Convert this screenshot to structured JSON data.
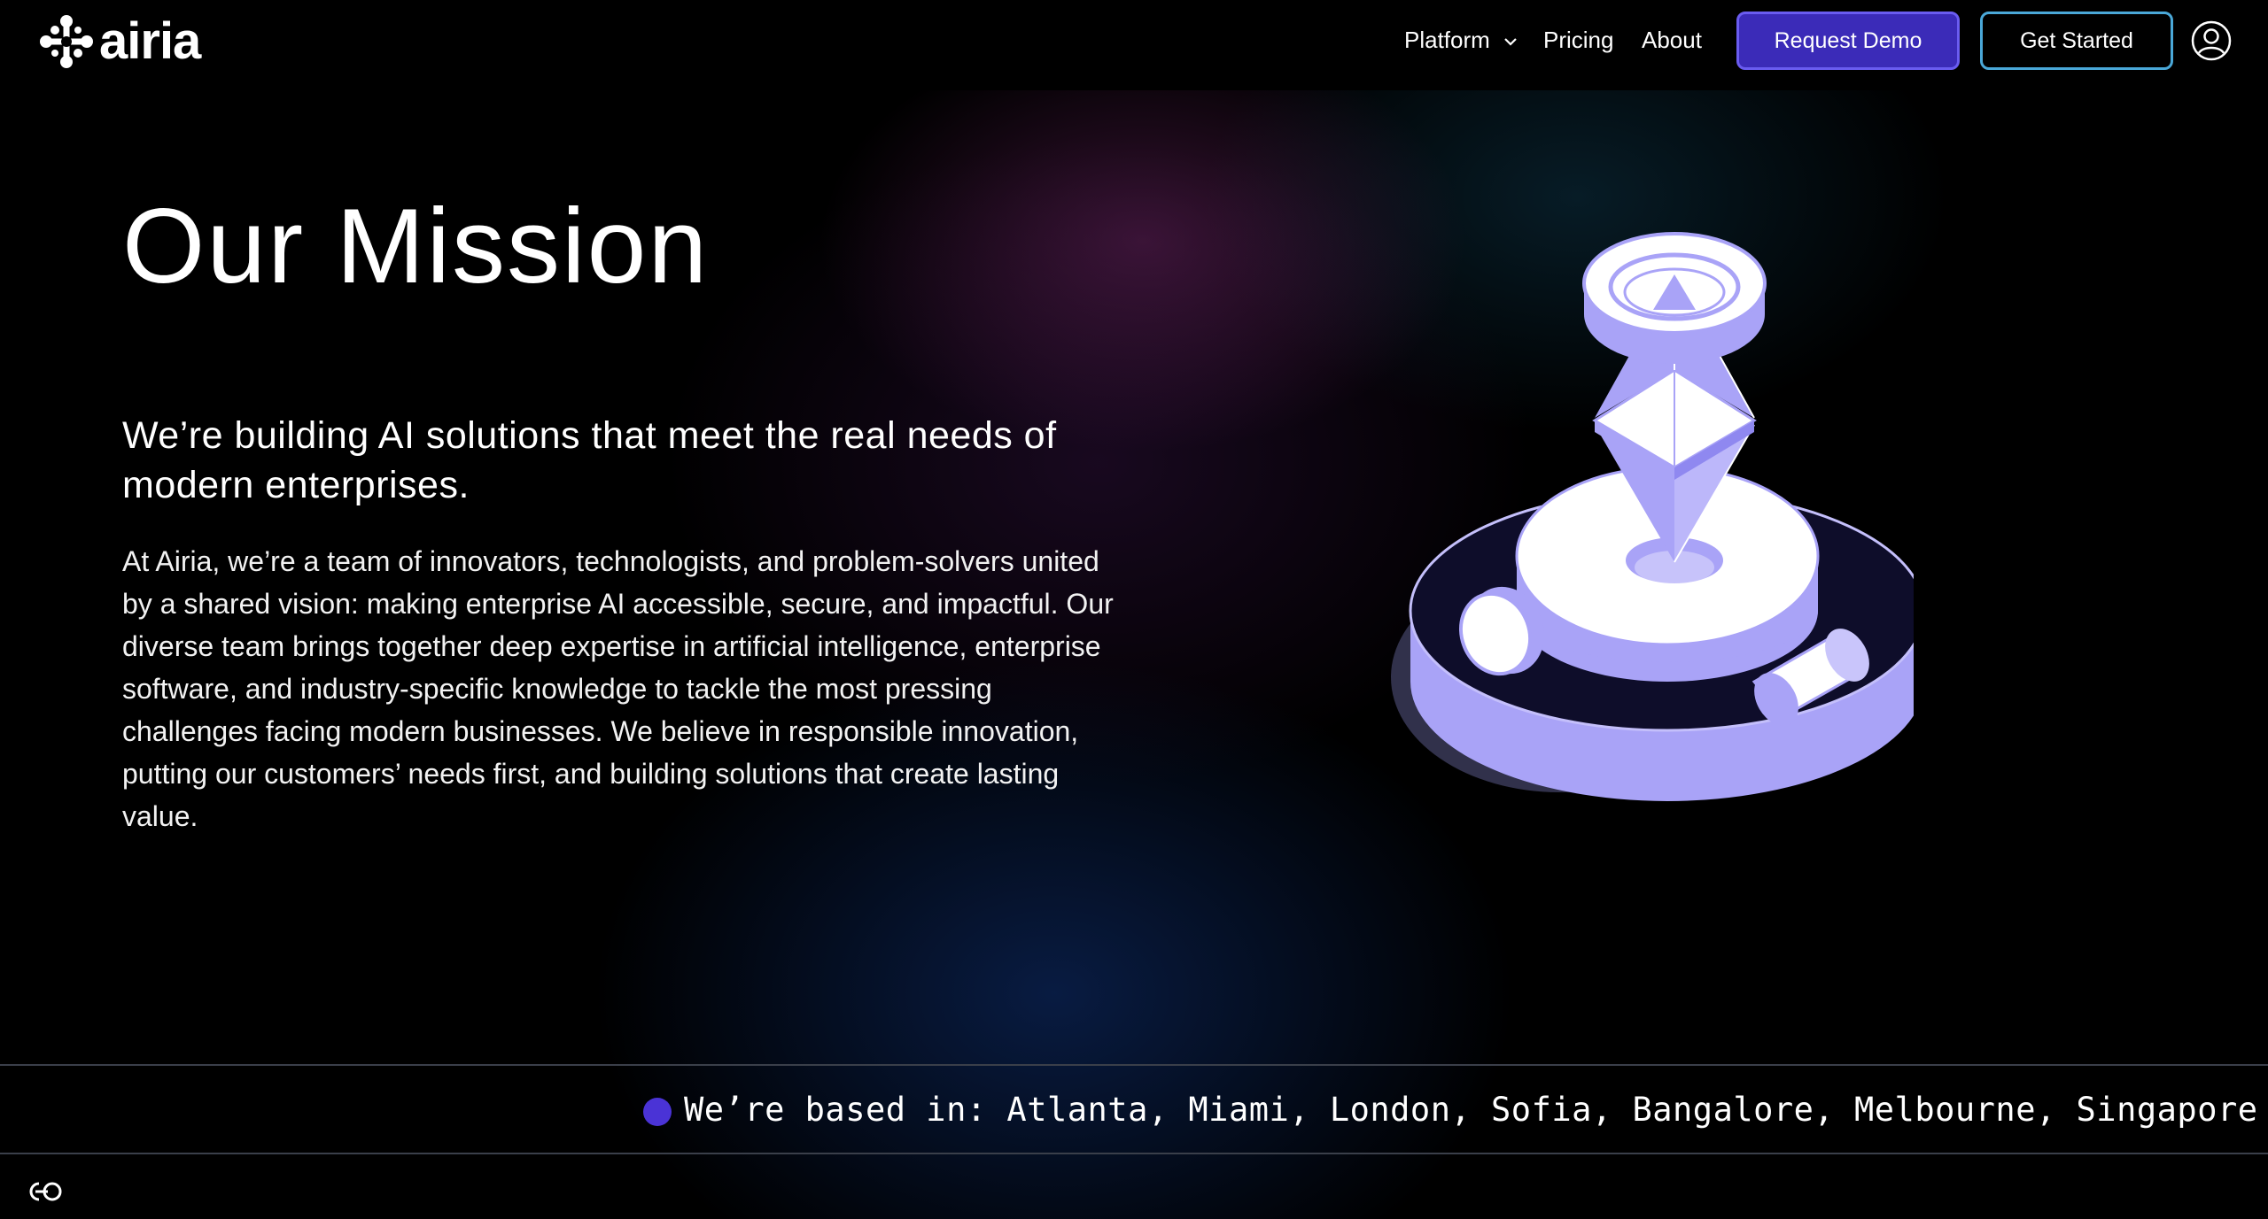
{
  "brand": {
    "name": "airia"
  },
  "nav": {
    "platform_label": "Platform",
    "pricing_label": "Pricing",
    "about_label": "About",
    "request_demo_label": "Request Demo",
    "get_started_label": "Get Started"
  },
  "hero": {
    "title": "Our Mission",
    "lead": "We’re building AI solutions that meet the real needs of modern enterprises.",
    "body": "At Airia, we’re a team of innovators, technologists, and problem-solvers united by a shared vision: making enterprise AI accessible, secure, and impactful. Our diverse team brings together deep expertise in artificial intelligence, enterprise software, and industry-specific knowledge to tackle the most pressing challenges facing modern businesses. We believe in responsible innovation, putting our customers’ needs first, and building solutions that create lasting value."
  },
  "locations": {
    "text": "We’re based in: Atlanta, Miami, London, Sofia, Bangalore, Melbourne, Singapore"
  },
  "colors": {
    "accent_purple": "#3b2bb8",
    "accent_border": "#6a5cf0",
    "accent_cyan": "#4aa8d8",
    "illustration_lavender": "#a9a3f7"
  },
  "icons": [
    "airia-logo-icon",
    "chevron-down-icon",
    "user-account-icon",
    "location-dot-icon",
    "ai-model-illustration",
    "cookie-settings-icon"
  ]
}
